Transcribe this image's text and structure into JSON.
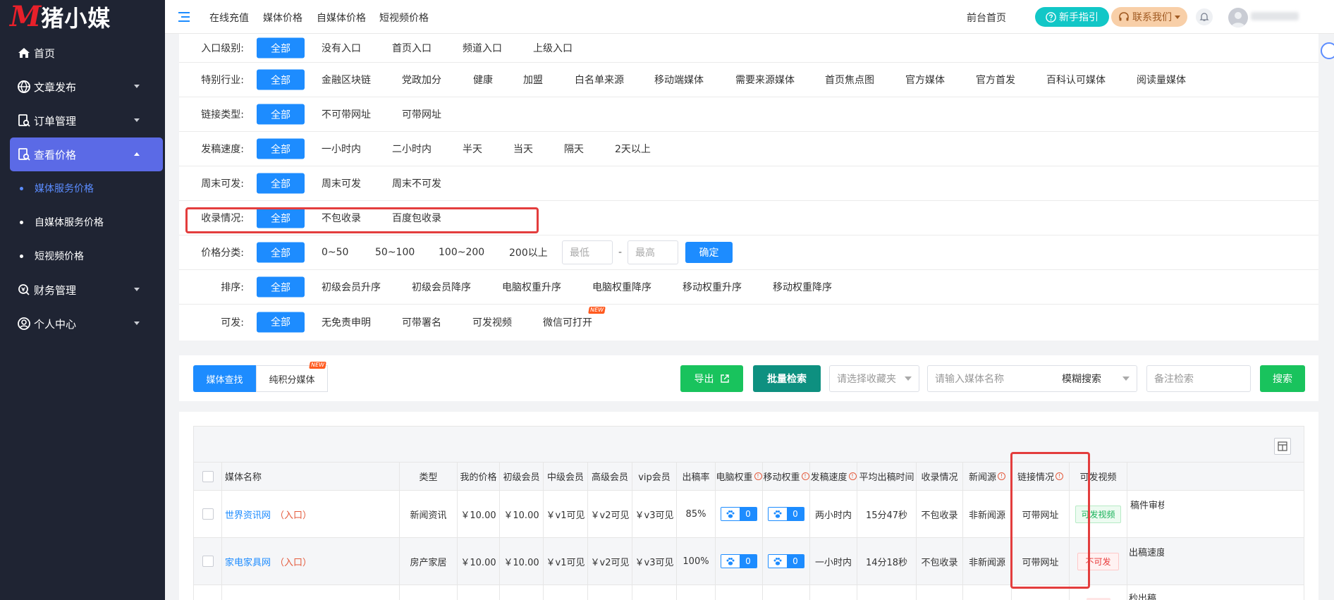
{
  "logo": {
    "mark": "M",
    "text": "猪小媒"
  },
  "sidebar": {
    "items": [
      {
        "label": "首页",
        "icon": "home-icon"
      },
      {
        "label": "文章发布",
        "icon": "globe-icon"
      },
      {
        "label": "订单管理",
        "icon": "document-search-icon"
      },
      {
        "label": "查看价格",
        "icon": "price-search-icon"
      },
      {
        "label": "财务管理",
        "icon": "finance-icon"
      },
      {
        "label": "个人中心",
        "icon": "user-circle-icon"
      }
    ],
    "sub_items": [
      "媒体服务价格",
      "自媒体服务价格",
      "短视频价格"
    ]
  },
  "topbar": {
    "nav": [
      "在线充值",
      "媒体价格",
      "自媒体价格",
      "短视频价格"
    ],
    "home_link": "前台首页",
    "guide_btn": "新手指引",
    "contact_btn": "联系我们"
  },
  "filters": [
    {
      "label": "入口级别:",
      "options": [
        "全部",
        "没有入口",
        "首页入口",
        "频道入口",
        "上级入口"
      ]
    },
    {
      "label": "特别行业:",
      "options": [
        "全部",
        "金融区块链",
        "党政加分",
        "健康",
        "加盟",
        "白名单来源",
        "移动端媒体",
        "需要来源媒体",
        "首页焦点图",
        "官方媒体",
        "官方首发",
        "百科认可媒体",
        "阅读量媒体"
      ]
    },
    {
      "label": "链接类型:",
      "options": [
        "全部",
        "不可带网址",
        "可带网址"
      ]
    },
    {
      "label": "发稿速度:",
      "options": [
        "全部",
        "一小时内",
        "二小时内",
        "半天",
        "当天",
        "隔天",
        "2天以上"
      ]
    },
    {
      "label": "周末可发:",
      "options": [
        "全部",
        "周末可发",
        "周末不可发"
      ]
    },
    {
      "label": "收录情况:",
      "options": [
        "全部",
        "不包收录",
        "百度包收录"
      ]
    },
    {
      "label": "价格分类:",
      "options": [
        "全部",
        "0~50",
        "50~100",
        "100~200",
        "200以上"
      ],
      "min_placeholder": "最低",
      "max_placeholder": "最高",
      "separator": "-",
      "confirm": "确定"
    },
    {
      "label": "排序:",
      "options": [
        "全部",
        "初级会员升序",
        "初级会员降序",
        "电脑权重升序",
        "电脑权重降序",
        "移动权重升序",
        "移动权重降序"
      ]
    },
    {
      "label": "可发:",
      "options": [
        "全部",
        "无免责申明",
        "可带署名",
        "可发视频",
        "微信可打开"
      ],
      "new_badge": "NEW"
    }
  ],
  "search": {
    "tab_active": "媒体查找",
    "tab_other": "纯积分媒体",
    "tab_badge": "NEW",
    "export": "导出",
    "batch": "批量检索",
    "favorite_placeholder": "请选择收藏夹",
    "name_placeholder": "请输入媒体名称",
    "mode": "模糊搜索",
    "note_placeholder": "备注检索",
    "search_btn": "搜索"
  },
  "table": {
    "headers": [
      "媒体名称",
      "类型",
      "我的价格",
      "初级会员",
      "中级会员",
      "高级会员",
      "vip会员",
      "出稿率",
      "电脑权重",
      "移动权重",
      "发稿速度",
      "平均出稿时间",
      "收录情况",
      "新闻源",
      "链接情况",
      "可发视频"
    ],
    "rows": [
      {
        "name": "世界资讯网",
        "entry": "（入口）",
        "type": "新闻资讯",
        "my_price": "￥10.00",
        "junior": "￥10.00",
        "mid": "￥v1可见",
        "senior": "￥v2可见",
        "vip": "￥v3可见",
        "rate": "85%",
        "pc_weight": "0",
        "mobile_weight": "0",
        "speed": "两小时内",
        "avg_time": "15分47秒",
        "index": "不包收录",
        "news": "非新闻源",
        "link": "可带网址",
        "video": "可发视频",
        "video_status": "ok",
        "extra": "稿件审核"
      },
      {
        "name": "家电家具网",
        "entry": "（入口）",
        "type": "房产家居",
        "my_price": "￥10.00",
        "junior": "￥10.00",
        "mid": "￥v1可见",
        "senior": "￥v2可见",
        "vip": "￥v3可见",
        "rate": "100%",
        "pc_weight": "0",
        "mobile_weight": "0",
        "speed": "一小时内",
        "avg_time": "14分18秒",
        "index": "不包收录",
        "news": "非新闻源",
        "link": "可带网址",
        "video": "不可发",
        "video_status": "no",
        "extra": "出稿速度"
      }
    ],
    "partial_extra": "秒出稿,"
  },
  "colors": {
    "primary": "#1d8cff",
    "sidebar": "#1f2433",
    "active_nav": "#5b6ae6",
    "highlight": "#e33d3d",
    "export_green": "#19c35d",
    "batch_teal": "#0e9080"
  }
}
